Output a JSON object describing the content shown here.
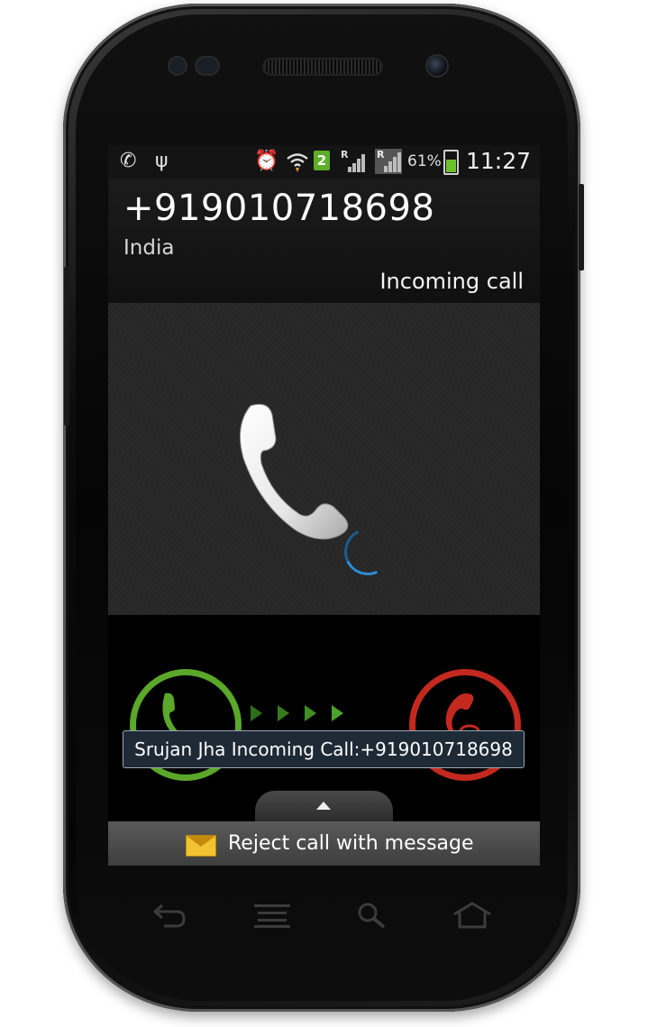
{
  "statusbar": {
    "icons": [
      "phone-icon",
      "usb-icon",
      "alarm-icon",
      "wifi-icon",
      "sim-2-icon",
      "roaming-signal-icon",
      "roaming-signal-icon",
      "battery-charging-icon"
    ],
    "sim_slot": "2",
    "roaming_label": "R",
    "battery_percent": "61%",
    "time": "11:27"
  },
  "caller": {
    "number": "+919010718698",
    "country": "India",
    "state": "Incoming call"
  },
  "controls": {
    "answer_icon": "answer-phone-icon",
    "reject_icon": "reject-phone-icon",
    "answer_color": "#5ba72a",
    "reject_color": "#c3291f",
    "arrow_color": "#3f8a22"
  },
  "toast": {
    "text": "Srujan Jha Incoming Call:+919010718698"
  },
  "reject_message": {
    "label": "Reject call with message",
    "icon": "envelope-icon"
  },
  "navkeys": [
    "back-icon",
    "menu-icon",
    "search-icon",
    "home-icon"
  ]
}
